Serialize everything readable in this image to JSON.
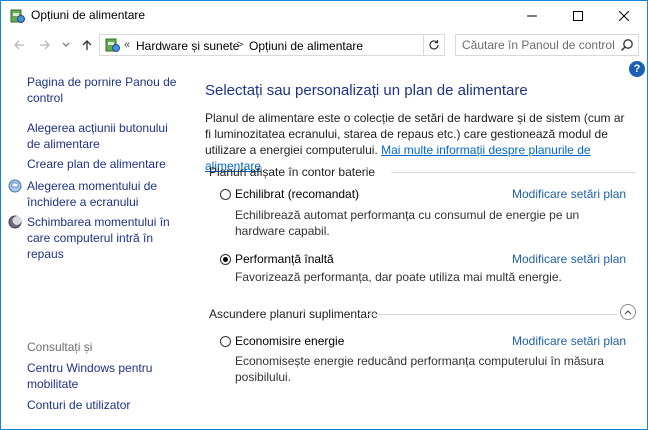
{
  "window": {
    "title": "Opțiuni de alimentare",
    "accent": "#1883d7",
    "title_icon": "power-options-icon"
  },
  "address_bar": {
    "location_icon": "power-options-icon",
    "overflow": "«",
    "crumbs": [
      "Hardware și sunete",
      "Opțiuni de alimentare"
    ],
    "separator": ">"
  },
  "search": {
    "placeholder": "Căutare în Panoul de control"
  },
  "sidebar": {
    "home_link": "Pagina de pornire Panou de control",
    "links": [
      {
        "label": "Alegerea acțiunii butonului de alimentare",
        "icon": ""
      },
      {
        "label": "Creare plan de alimentare",
        "icon": ""
      },
      {
        "label": "Alegerea momentului de închidere a ecranului",
        "icon": "display-icon"
      },
      {
        "label": "Schimbarea momentului în care computerul intră în repaus",
        "icon": "moon-icon"
      }
    ],
    "see_also": "Consultați și",
    "see_also_links": [
      "Centru Windows pentru mobilitate",
      "Conturi de utilizator"
    ]
  },
  "main": {
    "title": "Selectați sau personalizați un plan de alimentare",
    "intro": "Planul de alimentare este o colecție de setări de hardware și de sistem (cum ar fi luminozitatea ecranului, starea de repaus etc.) care gestionează modul de utilizare a energiei computerului.",
    "intro_link": "Mai multe informații despre planurile de alimentare",
    "group_battery": "Planuri afișate în contor baterie",
    "group_hidden": "Ascundere planuri suplimentare",
    "change_label": "Modificare setări plan",
    "plans": [
      {
        "name": "Echilibrat (recomandat)",
        "desc": "Echilibrează automat performanța cu consumul de energie pe un hardware capabil.",
        "selected": false
      },
      {
        "name": "Performanță înaltă",
        "desc": "Favorizează performanța, dar poate utiliza mai multă energie.",
        "selected": true
      },
      {
        "name": "Economisire energie",
        "desc": "Economisește energie reducând performanța computerului în măsura posibilului.",
        "selected": false
      }
    ]
  }
}
